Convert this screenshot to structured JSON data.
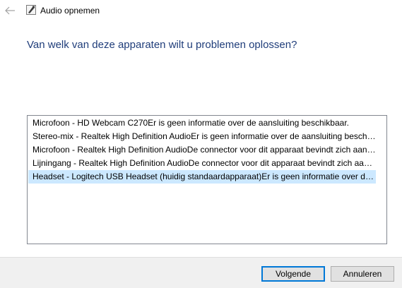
{
  "window": {
    "title": "Audio opnemen",
    "icons": {
      "back": "back-arrow-icon",
      "app": "troubleshooter-icon"
    }
  },
  "heading": "Van welk van deze apparaten wilt u problemen oplossen?",
  "devices": {
    "items": [
      {
        "label": "Microfoon - HD Webcam C270Er is geen informatie over de aansluiting beschikbaar.",
        "selected": false
      },
      {
        "label": "Stereo-mix - Realtek High Definition AudioEr is geen informatie over de aansluiting beschikbaar.",
        "selected": false
      },
      {
        "label": "Microfoon - Realtek High Definition AudioDe connector voor dit apparaat bevindt zich aan de achterkant.",
        "selected": false
      },
      {
        "label": "Lijningang - Realtek High Definition AudioDe connector voor dit apparaat bevindt zich aan de achterkant.",
        "selected": false
      },
      {
        "label": "Headset - Logitech USB Headset (huidig standaardapparaat)Er is geen informatie over de aansluiting beschikbaar.",
        "selected": true
      }
    ]
  },
  "buttons": {
    "next_label": "Volgende",
    "cancel_label": "Annuleren"
  },
  "colors": {
    "heading": "#1f3d7a",
    "selection": "#cce8ff",
    "accent": "#0078d7",
    "footer": "#f0f0f0"
  }
}
